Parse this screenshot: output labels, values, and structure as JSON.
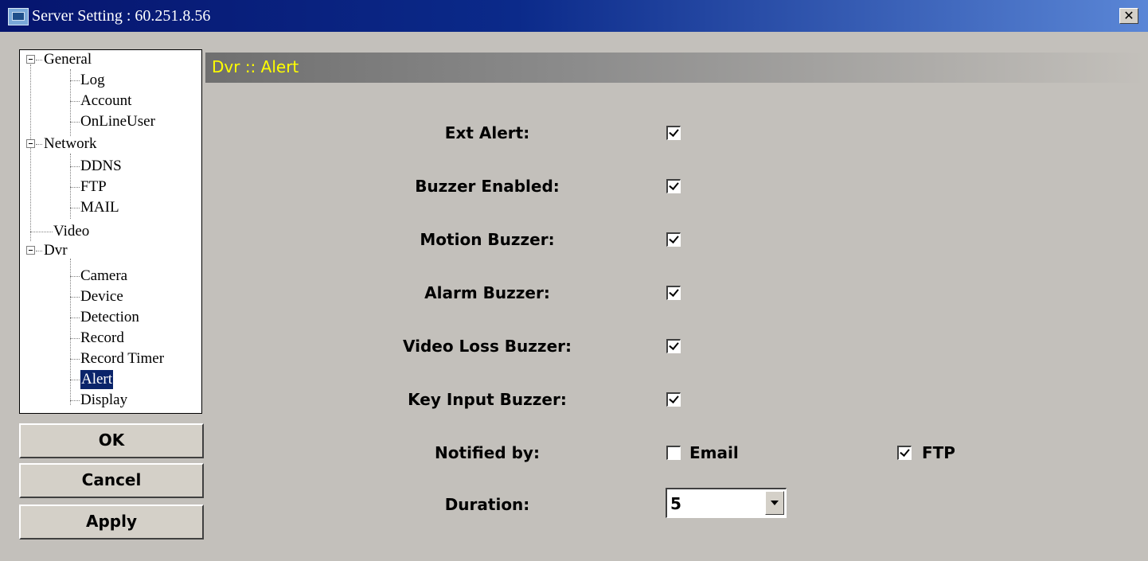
{
  "window": {
    "title": "Server Setting : 60.251.8.56",
    "close_glyph": "✕"
  },
  "tree": {
    "items": [
      {
        "label": "General"
      },
      {
        "label": "Log"
      },
      {
        "label": "Account"
      },
      {
        "label": "OnLineUser"
      },
      {
        "label": "Network"
      },
      {
        "label": "DDNS"
      },
      {
        "label": "FTP"
      },
      {
        "label": "MAIL"
      },
      {
        "label": "Video"
      },
      {
        "label": "Dvr"
      },
      {
        "label": "Camera"
      },
      {
        "label": "Device"
      },
      {
        "label": "Detection"
      },
      {
        "label": "Record"
      },
      {
        "label": "Record Timer"
      },
      {
        "label": "Alert"
      },
      {
        "label": "Display"
      }
    ],
    "selected": "Alert"
  },
  "buttons": {
    "ok": "OK",
    "cancel": "Cancel",
    "apply": "Apply"
  },
  "panel": {
    "title": "Dvr :: Alert"
  },
  "form": {
    "ext_alert": {
      "label": "Ext Alert:",
      "checked": true
    },
    "buzzer_enabled": {
      "label": "Buzzer Enabled:",
      "checked": true
    },
    "motion_buzzer": {
      "label": "Motion Buzzer:",
      "checked": true
    },
    "alarm_buzzer": {
      "label": "Alarm Buzzer:",
      "checked": true
    },
    "video_loss_buzzer": {
      "label": "Video Loss Buzzer:",
      "checked": true
    },
    "key_input_buzzer": {
      "label": "Key Input Buzzer:",
      "checked": true
    },
    "notified_by": {
      "label": "Notified by:",
      "email": {
        "label": "Email",
        "checked": false
      },
      "ftp": {
        "label": "FTP",
        "checked": true
      }
    },
    "duration": {
      "label": "Duration:",
      "value": "5"
    }
  },
  "icons": {
    "app": "server-window-icon",
    "close": "close-icon",
    "expander": "tree-collapse-icon",
    "dropdown": "chevron-down-icon"
  }
}
